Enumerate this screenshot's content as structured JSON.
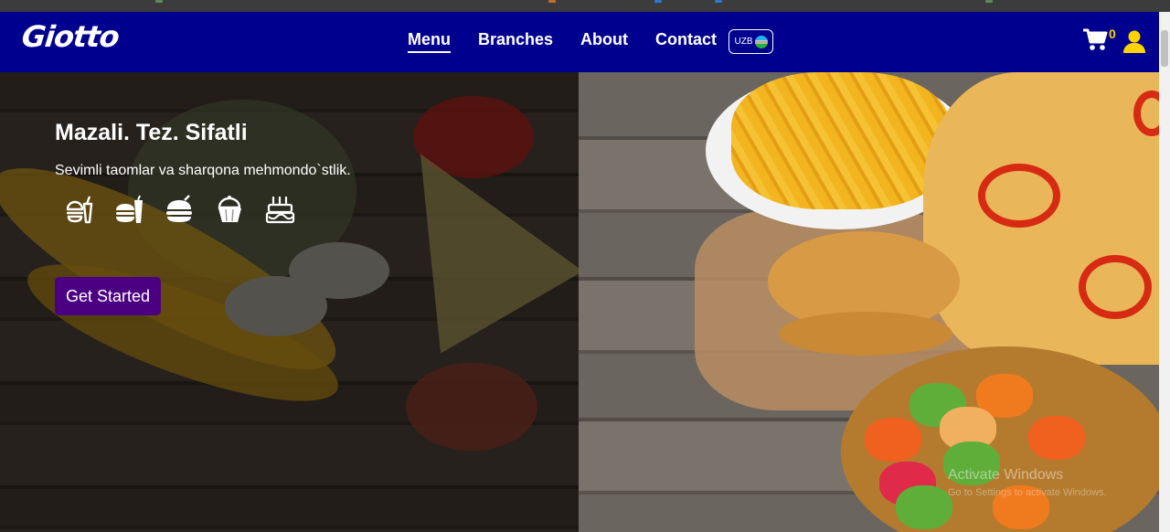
{
  "brand": {
    "logo_text": "Giotto",
    "accent": "#00008f",
    "cta_color": "#4b0082"
  },
  "nav": {
    "links": [
      {
        "label": "Menu",
        "active": true
      },
      {
        "label": "Branches",
        "active": false
      },
      {
        "label": "About",
        "active": false
      },
      {
        "label": "Contact",
        "active": false
      }
    ],
    "language": {
      "label": "UZB",
      "flag_icon": "uzbekistan-flag-icon"
    },
    "cart": {
      "icon": "cart-icon",
      "count": "0"
    },
    "user": {
      "icon": "user-icon"
    }
  },
  "hero": {
    "title": "Mazali. Tez. Sifatli",
    "subtitle": "Sevimli taomlar va sharqona mehmondo`stlik.",
    "icons": [
      "fastfood-combo-icon",
      "burger-drink-icon",
      "burger-icon",
      "cupcake-icon",
      "birthday-cake-icon"
    ],
    "cta_label": "Get Started"
  },
  "os_watermark": {
    "title": "Activate Windows",
    "subtitle": "Go to Settings to activate Windows."
  }
}
